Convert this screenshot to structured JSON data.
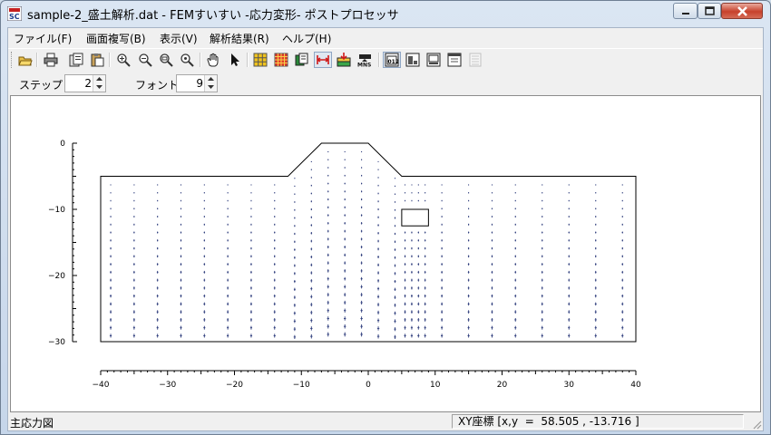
{
  "window": {
    "title": "sample-2_盛土解析.dat - FEMすいすい -応力変形- ポストプロセッサ",
    "icon": "app-logo-icon",
    "controls": [
      "minimize-icon",
      "maximize-icon",
      "close-icon"
    ]
  },
  "menu": [
    {
      "label": "ファイル(F)"
    },
    {
      "label": "画面複写(B)"
    },
    {
      "label": "表示(V)"
    },
    {
      "label": "解析結果(R)"
    },
    {
      "label": "ヘルプ(H)"
    }
  ],
  "toolbar": {
    "buttons": [
      {
        "icon": "open-folder-icon"
      },
      {
        "icon": "print-icon"
      },
      {
        "icon": "copy-icon"
      },
      {
        "icon": "paste-icon"
      },
      {
        "icon": "zoom-fit-icon"
      },
      {
        "icon": "zoom-in-icon"
      },
      {
        "icon": "zoom-out-icon"
      },
      {
        "icon": "zoom-reset-icon"
      },
      {
        "icon": "pan-hand-icon"
      },
      {
        "icon": "select-arrow-icon"
      },
      {
        "icon": "mesh-icon"
      },
      {
        "icon": "grid-mesh-icon"
      },
      {
        "icon": "material-icon"
      },
      {
        "icon": "dimension-icon"
      },
      {
        "icon": "load-icon"
      },
      {
        "icon": "mns-icon"
      },
      {
        "icon": "view-1-icon"
      },
      {
        "icon": "view-2-icon"
      },
      {
        "icon": "view-3-icon"
      },
      {
        "icon": "view-4-icon"
      },
      {
        "icon": "view-5-icon"
      }
    ]
  },
  "options": {
    "step_label": "ステップ",
    "step_value": "2",
    "font_label": "フォント",
    "font_value": "9"
  },
  "plot": {
    "y_ticks": [
      "0",
      "−10",
      "−20",
      "−30"
    ],
    "x_ticks": [
      "−40",
      "−30",
      "−20",
      "−10",
      "0",
      "10",
      "20",
      "30",
      "40"
    ],
    "x_range": [
      -40,
      40
    ],
    "y_range": [
      -30,
      0
    ],
    "ground_top_y": -5,
    "embankment": {
      "base_left_x": -12,
      "crest_left_x": -7,
      "crest_right_x": 0,
      "base_right_x": 5
    },
    "culvert": {
      "x1": 5,
      "x2": 9,
      "y1": -10,
      "y2": -12.5
    },
    "stress_color": "#2b3a7a",
    "stress_columns_x": [
      -38.5,
      -35,
      -31.5,
      -28,
      -24.5,
      -21,
      -17.5,
      -14,
      -11,
      -8.5,
      -6,
      -3.5,
      -1,
      1.5,
      4,
      5.5,
      6.5,
      7.5,
      8.5,
      11,
      15,
      18.5,
      22,
      26,
      30,
      34,
      38
    ]
  },
  "status": {
    "left": "主応力図",
    "right": "XY座標 [x,y  =  58.505 , -13.716 ]"
  }
}
